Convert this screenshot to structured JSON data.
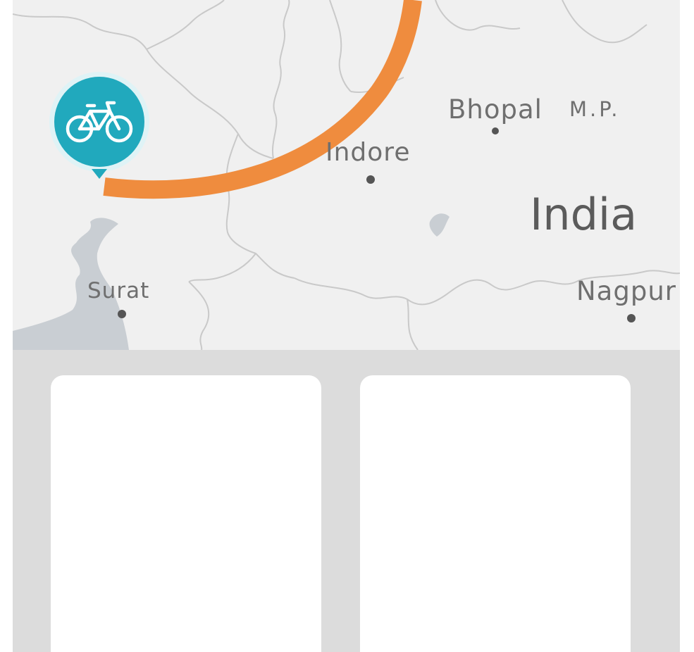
{
  "map": {
    "labels": {
      "bhopal": "Bhopal",
      "mp": "M.P.",
      "indore": "Indore",
      "country": "India",
      "surat": "Surat",
      "nagpur": "Nagpur"
    },
    "route_color": "#ef8c3e",
    "pin": {
      "icon": "bicycle-icon",
      "color": "#21a9bd"
    },
    "background_color": "#f0f0f0",
    "water_color": "#c9ced3"
  },
  "cards": [
    {
      "id": "card-1"
    },
    {
      "id": "card-2"
    }
  ]
}
